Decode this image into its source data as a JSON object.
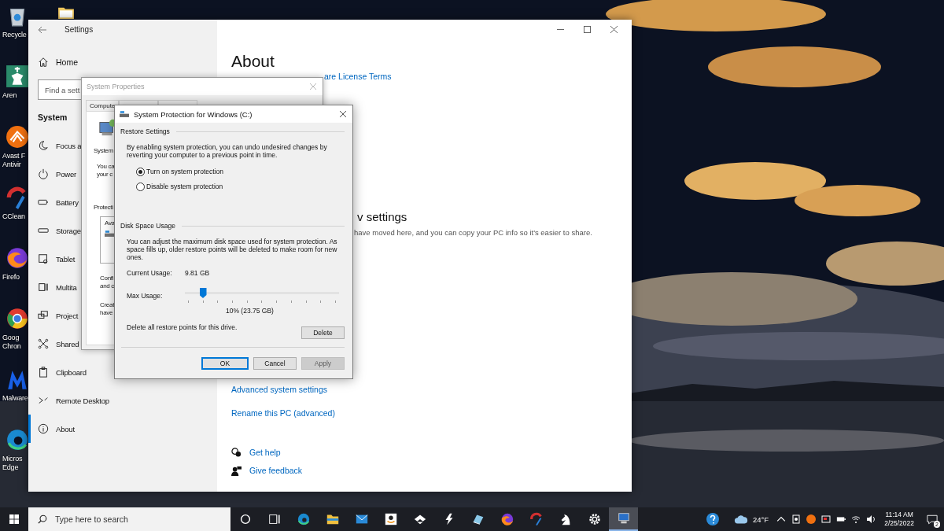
{
  "desktop_icons": [
    {
      "lines": [
        "Recycle"
      ]
    },
    {
      "lines": [
        "Aren"
      ]
    },
    {
      "lines": [
        "Avast F",
        "Antivir"
      ]
    },
    {
      "lines": [
        "CClean"
      ]
    },
    {
      "lines": [
        "Firefo"
      ]
    },
    {
      "lines": [
        "Goog",
        "Chron"
      ]
    },
    {
      "lines": [
        "Malware"
      ]
    },
    {
      "lines": [
        "Micros",
        "Edge"
      ]
    }
  ],
  "settings": {
    "title": "Settings",
    "home": "Home",
    "search": {
      "placeholder": "Find a sett"
    },
    "section": "System",
    "nav": [
      {
        "label": "Focus a",
        "selected": false
      },
      {
        "label": "Power",
        "selected": false
      },
      {
        "label": "Battery",
        "selected": false
      },
      {
        "label": "Storage",
        "selected": false
      },
      {
        "label": "Tablet",
        "selected": false
      },
      {
        "label": "Multita",
        "selected": false
      },
      {
        "label": "Project",
        "selected": false
      },
      {
        "label": "Shared",
        "selected": false
      },
      {
        "label": "Clipboard",
        "selected": false
      },
      {
        "label": "Remote Desktop",
        "selected": false
      },
      {
        "label": "About",
        "selected": true
      }
    ],
    "page_title": "About",
    "license_link": "are License Terms",
    "new_settings_heading": "v settings",
    "new_settings_text": "have moved here, and you can copy your PC info so it's easier to share.",
    "related_links": [
      "Advanced system settings",
      "Rename this PC (advanced)"
    ],
    "help_links": [
      "Get help",
      "Give feedback"
    ]
  },
  "system_properties": {
    "title": "System Properties",
    "tab": "Compute",
    "section_label": "System",
    "intro": [
      "You ca",
      "your c"
    ],
    "protection_label": "Protecti",
    "drive_list": [
      "Ava"
    ],
    "configure": [
      "Confi",
      "and c"
    ],
    "create": [
      "Creat",
      "have"
    ]
  },
  "dialog": {
    "title": "System Protection for Windows (C:)",
    "restore_group": "Restore Settings",
    "restore_text": "By enabling system protection, you can undo undesired changes by reverting your computer to a previous point in time.",
    "options": [
      {
        "label": "Turn on system protection",
        "selected": true
      },
      {
        "label": "Disable system protection",
        "selected": false
      }
    ],
    "disk_group": "Disk Space Usage",
    "disk_text": "You can adjust the maximum disk space used for system protection. As space fills up, older restore points will be deleted to make room for new ones.",
    "current_usage_label": "Current Usage:",
    "current_usage": "9.81 GB",
    "max_usage_label": "Max Usage:",
    "max_usage": {
      "level": 0.1
    },
    "max_usage_reading": "10% (23.75 GB)",
    "delete_text": "Delete all restore points for this drive.",
    "delete_button": "Delete",
    "buttons": [
      {
        "label": "OK",
        "kind": "default"
      },
      {
        "label": "Cancel",
        "kind": "normal"
      },
      {
        "label": "Apply",
        "kind": "disabled"
      }
    ]
  },
  "taskbar": {
    "search": {
      "placeholder": "Type here to search"
    },
    "apps": [
      {
        "selected": false
      },
      {
        "selected": false
      },
      {
        "selected": false
      },
      {
        "selected": false
      },
      {
        "selected": false
      },
      {
        "selected": false
      },
      {
        "selected": false
      },
      {
        "selected": false
      },
      {
        "selected": false
      },
      {
        "selected": false
      },
      {
        "selected": false
      },
      {
        "selected": false
      },
      {
        "selected": false
      },
      {
        "selected": true
      }
    ],
    "temperature": "24°F",
    "time": "11:14 AM",
    "date": "2/25/2022",
    "notifications": "2"
  }
}
